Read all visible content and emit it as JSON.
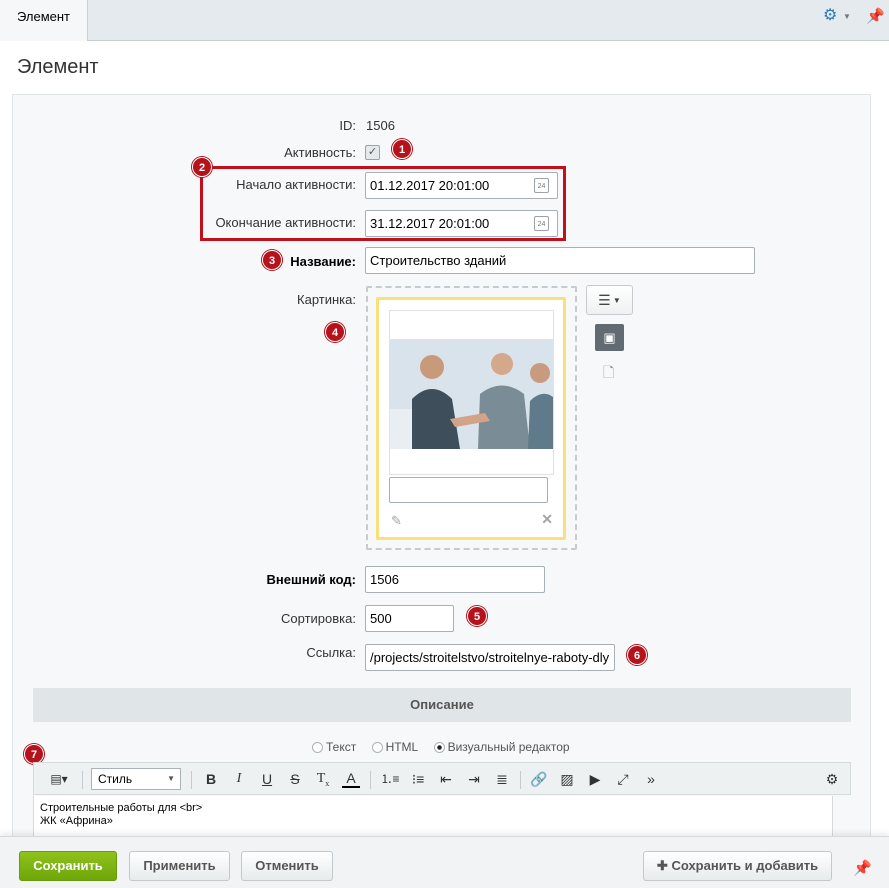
{
  "tab": {
    "label": "Элемент"
  },
  "page": {
    "title": "Элемент"
  },
  "form": {
    "id_label": "ID:",
    "id_value": "1506",
    "active_label": "Активность:",
    "active_checked": true,
    "start_label": "Начало активности:",
    "start_value": "01.12.2017 20:01:00",
    "end_label": "Окончание активности:",
    "end_value": "31.12.2017 20:01:00",
    "name_label": "Название:",
    "name_value": "Строительство зданий",
    "picture_label": "Картинка:",
    "external_code_label": "Внешний код:",
    "external_code_value": "1506",
    "sort_label": "Сортировка:",
    "sort_value": "500",
    "link_label": "Ссылка:",
    "link_value": "/projects/stroitelstvo/stroitelnye-raboty-dly"
  },
  "calendar_icon_text": "24",
  "badges": [
    "1",
    "2",
    "3",
    "4",
    "5",
    "6",
    "7"
  ],
  "description": {
    "section_title": "Описание",
    "modes": [
      "Текст",
      "HTML",
      "Визуальный редактор"
    ],
    "selected_mode": "Визуальный редактор",
    "style_select": "Стиль",
    "content_lines": [
      "Строительные работы для <br>",
      "ЖК «Африна»"
    ]
  },
  "footer": {
    "save": "Сохранить",
    "apply": "Применить",
    "cancel": "Отменить",
    "save_add": "Сохранить и добавить"
  },
  "colors": {
    "accent": "#2d7ab7",
    "badge": "#b5121b",
    "save_button": "#7cb312",
    "highlight_box": "#c0101b",
    "image_frame": "#f8e17a"
  },
  "icons": [
    "gear-icon",
    "pin-icon",
    "calendar-icon",
    "menu-icon",
    "image-icon",
    "file-icon",
    "pencil-icon",
    "delete-icon",
    "bold-icon",
    "italic-icon",
    "underline-icon",
    "strikethrough-icon",
    "clear-format-icon",
    "font-color-icon",
    "ordered-list-icon",
    "unordered-list-icon",
    "outdent-icon",
    "indent-icon",
    "align-icon",
    "link-icon",
    "insert-image-icon",
    "video-icon",
    "fullscreen-icon",
    "more-icon",
    "settings-icon",
    "plus-icon"
  ]
}
